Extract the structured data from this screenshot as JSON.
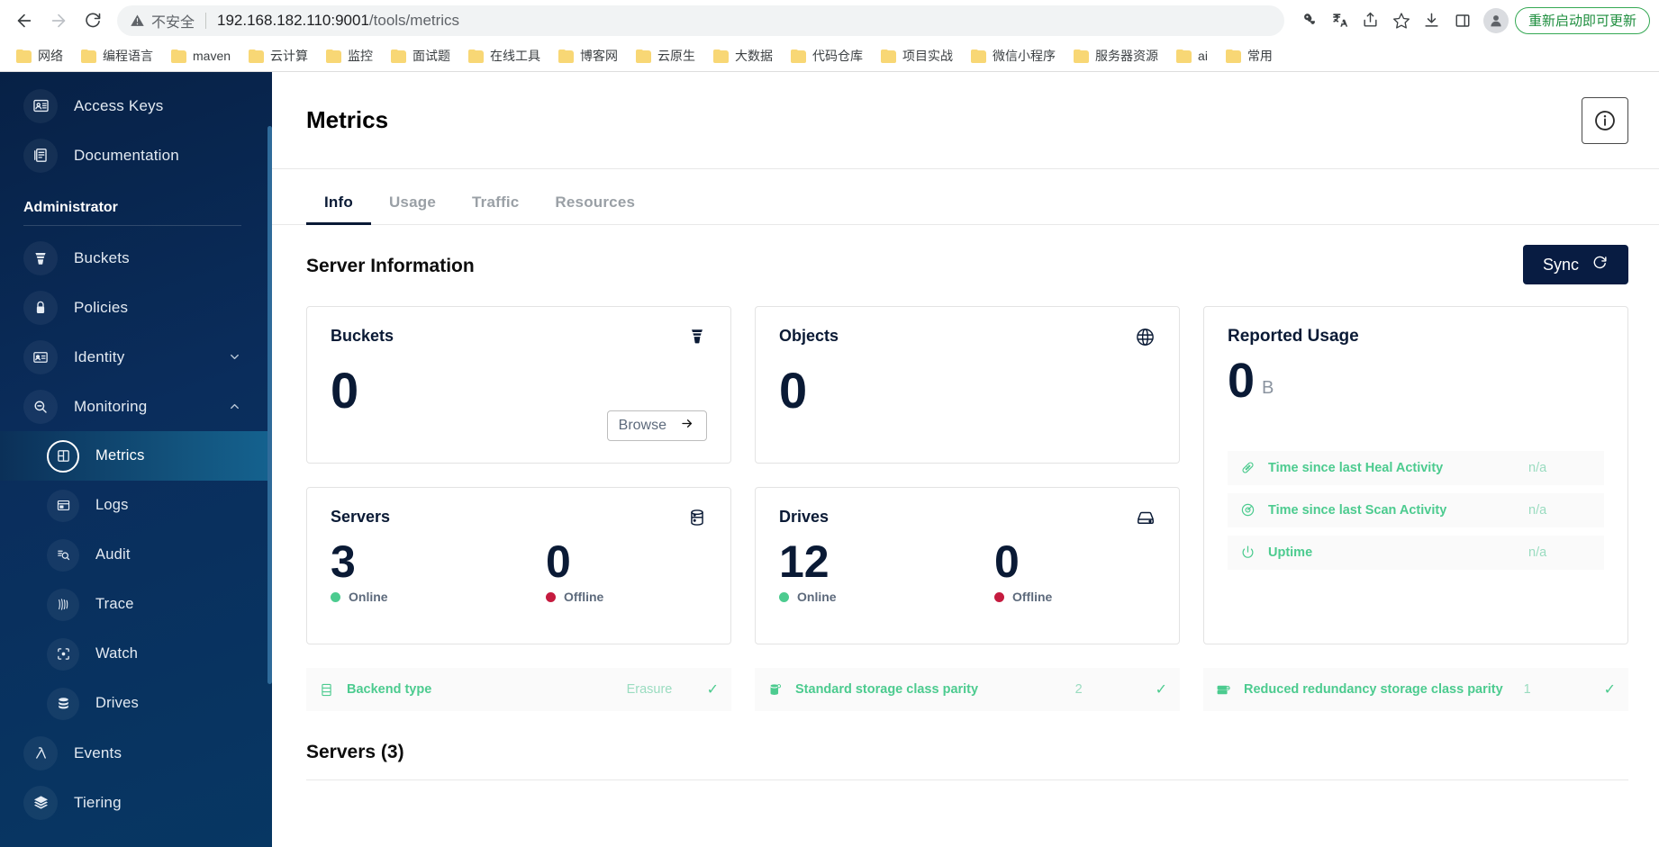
{
  "browser": {
    "back_icon": "back-arrow-icon",
    "forward_icon": "forward-arrow-icon",
    "reload_icon": "reload-icon",
    "security_label": "不安全",
    "url_host": "192.168.182.110:9001",
    "url_path": "/tools/metrics",
    "url_full": "192.168.182.110:9001/tools/metrics",
    "update_button_label": "重新启动即可更新",
    "toolbar_icons": [
      "password-key-icon",
      "translate-icon",
      "share-icon",
      "bookmark-star-icon",
      "download-icon",
      "side-panel-icon",
      "profile-avatar-icon"
    ],
    "bookmarks": [
      {
        "label": "网络"
      },
      {
        "label": "编程语言"
      },
      {
        "label": "maven"
      },
      {
        "label": "云计算"
      },
      {
        "label": "监控"
      },
      {
        "label": "面试题"
      },
      {
        "label": "在线工具"
      },
      {
        "label": "博客网"
      },
      {
        "label": "云原生"
      },
      {
        "label": "大数据"
      },
      {
        "label": "代码仓库"
      },
      {
        "label": "项目实战"
      },
      {
        "label": "微信小程序"
      },
      {
        "label": "服务器资源"
      },
      {
        "label": "ai"
      },
      {
        "label": "常用"
      }
    ]
  },
  "sidebar": {
    "top_items": [
      {
        "label": "Access Keys",
        "icon": "access-keys-icon"
      },
      {
        "label": "Documentation",
        "icon": "documentation-icon"
      }
    ],
    "section_title": "Administrator",
    "items": [
      {
        "label": "Buckets",
        "icon": "bucket-icon",
        "expandable": false
      },
      {
        "label": "Policies",
        "icon": "lock-icon",
        "expandable": false
      },
      {
        "label": "Identity",
        "icon": "identity-card-icon",
        "expandable": true,
        "expanded": false
      },
      {
        "label": "Monitoring",
        "icon": "monitoring-search-icon",
        "expandable": true,
        "expanded": true
      }
    ],
    "monitoring_children": [
      {
        "label": "Metrics",
        "icon": "metrics-grid-icon",
        "active": true
      },
      {
        "label": "Logs",
        "icon": "logs-icon",
        "active": false
      },
      {
        "label": "Audit",
        "icon": "audit-icon",
        "active": false
      },
      {
        "label": "Trace",
        "icon": "trace-icon",
        "active": false
      },
      {
        "label": "Watch",
        "icon": "watch-icon",
        "active": false
      },
      {
        "label": "Drives",
        "icon": "drives-database-icon",
        "active": false
      }
    ],
    "bottom_items": [
      {
        "label": "Events",
        "icon": "lambda-icon"
      },
      {
        "label": "Tiering",
        "icon": "layers-icon"
      }
    ]
  },
  "page": {
    "title": "Metrics",
    "help_icon": "help-info-icon"
  },
  "tabs": [
    {
      "label": "Info",
      "active": true
    },
    {
      "label": "Usage",
      "active": false
    },
    {
      "label": "Traffic",
      "active": false
    },
    {
      "label": "Resources",
      "active": false
    }
  ],
  "server_info": {
    "heading": "Server Information",
    "sync_button": "Sync",
    "sync_icon": "sync-refresh-icon",
    "cards": {
      "buckets": {
        "title": "Buckets",
        "value": "0",
        "icon": "bucket-icon",
        "browse_label": "Browse",
        "browse_icon": "arrow-right-icon"
      },
      "objects": {
        "title": "Objects",
        "value": "0",
        "icon": "objects-icon"
      },
      "servers": {
        "title": "Servers",
        "icon": "server-database-icon",
        "online_value": "3",
        "online_label": "Online",
        "offline_value": "0",
        "offline_label": "Offline"
      },
      "drives": {
        "title": "Drives",
        "icon": "hard-drive-icon",
        "online_value": "12",
        "online_label": "Online",
        "offline_value": "0",
        "offline_label": "Offline"
      }
    },
    "reported_usage": {
      "title": "Reported Usage",
      "value": "0",
      "unit": "B",
      "rows": [
        {
          "label": "Time since last Heal Activity",
          "value": "n/a",
          "icon": "heal-bandage-icon"
        },
        {
          "label": "Time since last Scan Activity",
          "value": "n/a",
          "icon": "scan-target-icon"
        },
        {
          "label": "Uptime",
          "value": "n/a",
          "icon": "uptime-power-icon"
        }
      ]
    },
    "info_pills": [
      {
        "label": "Backend type",
        "value": "Erasure",
        "icon": "backend-list-icon",
        "check": "✓"
      },
      {
        "label": "Standard storage class parity",
        "value": "2",
        "icon": "storage-parity-icon",
        "check": "✓"
      },
      {
        "label": "Reduced redundancy storage class parity",
        "value": "1",
        "icon": "reduced-redundancy-icon",
        "check": "✓"
      }
    ]
  },
  "servers_section": {
    "title": "Servers (3)"
  },
  "colors": {
    "sidebar_dark": "#072146",
    "sidebar_active": "#14628f",
    "accent_navy": "#081c42",
    "green": "#4ccb8f",
    "green_muted": "#9adcc0",
    "red": "#c51b3f",
    "text_muted": "#9aa0a6"
  }
}
